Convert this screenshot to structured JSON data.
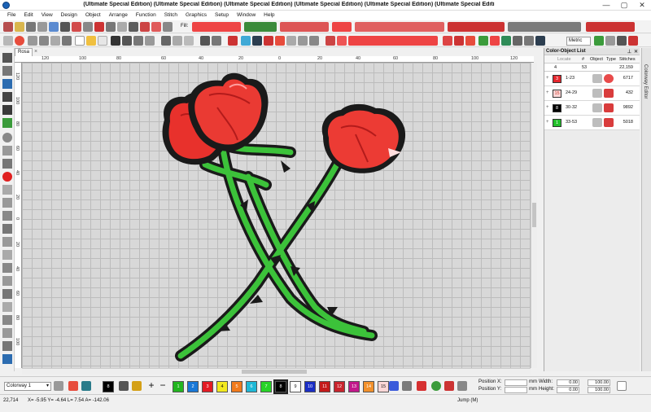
{
  "window": {
    "title": "(Ultimate Special Edition) (Ultimate Special Edition) (Ultimate Special Edition) (Ultimate Special Edition) (Ultimate Special Edition) (Ultimate Special Editi",
    "minimize": "—",
    "maximize": "▢",
    "close": "✕"
  },
  "menu": [
    "File",
    "Edit",
    "View",
    "Design",
    "Object",
    "Arrange",
    "Function",
    "Stitch",
    "Graphics",
    "Setup",
    "Window",
    "Help"
  ],
  "toolbar": {
    "fill_label": "Fill:",
    "units": "Metric"
  },
  "document": {
    "tab_name": "Rosa",
    "tab_close": "×"
  },
  "rulers": {
    "h": [
      "120",
      "100",
      "80",
      "60",
      "40",
      "20",
      "0",
      "20",
      "40",
      "60",
      "80",
      "100",
      "120"
    ],
    "v": [
      "120",
      "100",
      "80",
      "60",
      "40",
      "20",
      "0",
      "20",
      "40",
      "60",
      "80",
      "100",
      "120"
    ]
  },
  "panel": {
    "title": "Color-Object List",
    "headers": {
      "locate": "Locate",
      "num": "#",
      "obj": "Object",
      "type": "Type",
      "stitches": "Stitches"
    },
    "total": {
      "count": "4",
      "objects": "53",
      "stitches": "22,159"
    },
    "rows": [
      {
        "chip": "3",
        "range": "1-23",
        "stitches": "6717",
        "chip_color": "#e5262d",
        "chip_text_color": "#ffffff"
      },
      {
        "chip": "15",
        "range": "24-29",
        "stitches": "432",
        "chip_color": "#fdd7d7",
        "chip_text_color": "#c0392b"
      },
      {
        "chip": "8",
        "range": "30-32",
        "stitches": "9892",
        "chip_color": "#000000",
        "chip_text_color": "#ffffff"
      },
      {
        "chip": "1",
        "range": "33-53",
        "stitches": "5018",
        "chip_color": "#22c02a",
        "chip_text_color": "#ffffff"
      }
    ]
  },
  "side_tab": "Colorway Editor",
  "colorway": {
    "name": "Colorway 1",
    "current_chip": "8",
    "chips": [
      {
        "label": "1",
        "color": "#22b51f"
      },
      {
        "label": "2",
        "color": "#1877d6"
      },
      {
        "label": "3",
        "color": "#e31b23"
      },
      {
        "label": "4",
        "color": "#f2e91e"
      },
      {
        "label": "5",
        "color": "#f17a1c"
      },
      {
        "label": "6",
        "color": "#1fb8d6"
      },
      {
        "label": "7",
        "color": "#27d327"
      },
      {
        "label": "8",
        "color": "#000000"
      },
      {
        "label": "9",
        "color": "#ffffff"
      },
      {
        "label": "10",
        "color": "#1a2ec4"
      },
      {
        "label": "11",
        "color": "#c41b1b"
      },
      {
        "label": "12",
        "color": "#c8242d"
      },
      {
        "label": "13",
        "color": "#c2188b"
      },
      {
        "label": "14",
        "color": "#f2902b"
      },
      {
        "label": "15",
        "color": "#fdd7d7"
      }
    ]
  },
  "position": {
    "x_label": "Position X:",
    "y_label": "Position Y:",
    "width_label": "Width:",
    "height_label": "Height:",
    "x_unit": "mm",
    "y_unit": "mm",
    "w_val": "0.00",
    "h_val": "0.00",
    "w_pct": "100.00",
    "h_pct": "100.00"
  },
  "status": {
    "stitch_count": "22,714",
    "coords": "X= -5.95 Y= -4.64 L= 7.54 A= -142.06",
    "mode": "Jump (M)"
  }
}
